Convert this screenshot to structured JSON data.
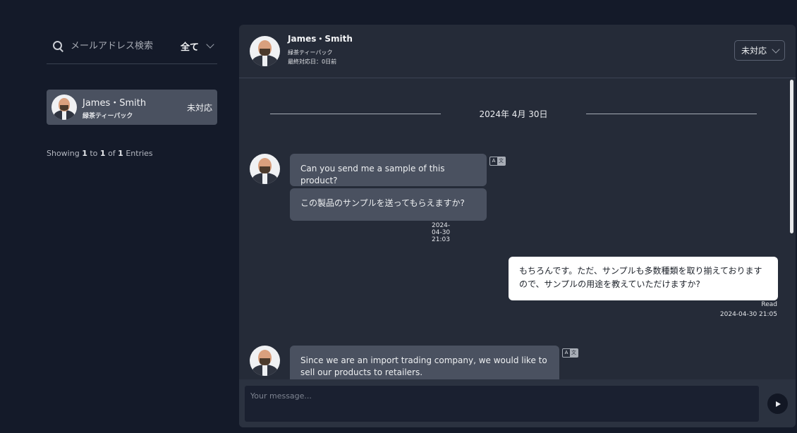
{
  "sidebar": {
    "search_placeholder": "メールアドレス検索",
    "filter_value": "全て",
    "contacts": [
      {
        "name": "James・Smith",
        "product": "緑茶ティーパック",
        "status": "未対応"
      }
    ],
    "entries": {
      "prefix": "Showing",
      "from": "1",
      "to_word": "to",
      "to": "1",
      "of_word": "of",
      "total": "1",
      "suffix": "Entries"
    }
  },
  "chat": {
    "header": {
      "name": "James・Smith",
      "product": "緑茶ティーパック",
      "last_response": "最終対応日：0日前",
      "status": "未対応"
    },
    "date_divider": "2024年 4月 30日",
    "messages": [
      {
        "direction": "in",
        "original": "Can you send me a sample of this product?",
        "translated": "この製品のサンプルを送ってもらえますか?",
        "time": "2024-04-30 21:03",
        "translate_icon_left": "A",
        "translate_icon_right": "文"
      },
      {
        "direction": "out",
        "text": "もちろんです。ただ、サンプルも多数種類を取り揃えておりますので、サンプルの用途を教えていただけますか?",
        "read_label": "Read",
        "time": "2024-04-30 21:05"
      },
      {
        "direction": "in",
        "original": "Since we are an import trading company, we would like to sell our products to retailers.",
        "translate_icon_left": "A",
        "translate_icon_right": "文"
      }
    ],
    "composer": {
      "placeholder": "Your message..."
    }
  },
  "colors": {
    "background": "#141a29",
    "panel": "#252b38",
    "bubble_in": "#4a5160",
    "bubble_out": "#ffffff",
    "accent_card": "#4a5160"
  },
  "icons": {
    "search": "search-icon",
    "chevron": "chevron-down-icon",
    "send": "send-icon",
    "translate": "translate-icon"
  }
}
